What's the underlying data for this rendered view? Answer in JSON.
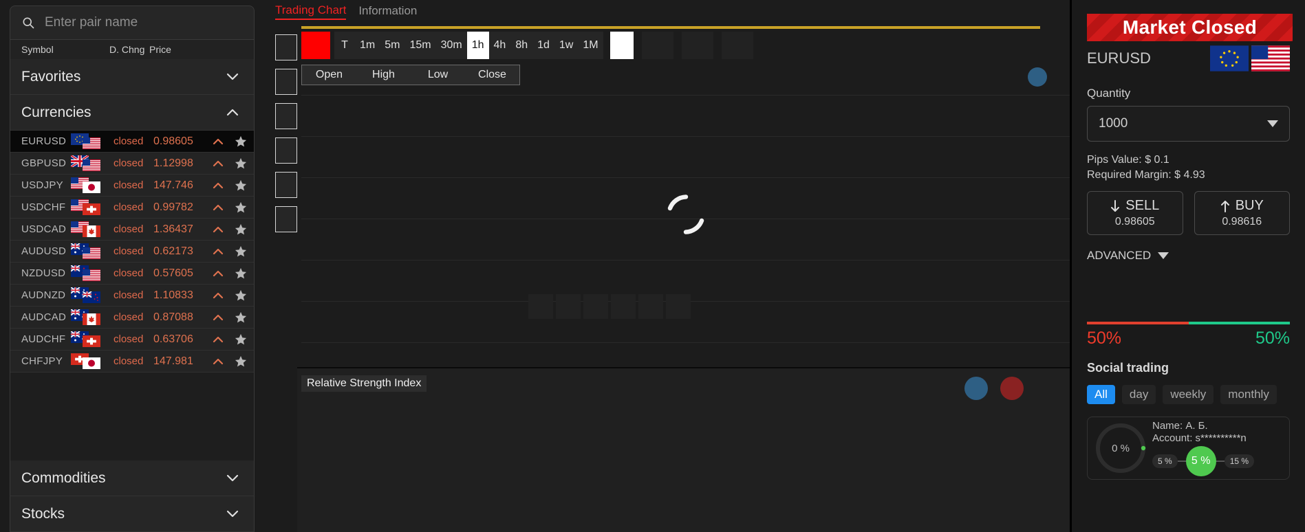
{
  "search": {
    "placeholder": "Enter pair name",
    "value": ""
  },
  "columns": {
    "symbol": "Symbol",
    "dchng": "D. Chng",
    "price": "Price"
  },
  "groups": {
    "favorites": "Favorites",
    "currencies": "Currencies",
    "commodities": "Commodities",
    "stocks": "Stocks"
  },
  "pairs": [
    {
      "symbol": "EURUSD",
      "status": "closed",
      "price": "0.98605",
      "f1": "eu",
      "f2": "us",
      "selected": true
    },
    {
      "symbol": "GBPUSD",
      "status": "closed",
      "price": "1.12998",
      "f1": "gb",
      "f2": "us",
      "selected": false
    },
    {
      "symbol": "USDJPY",
      "status": "closed",
      "price": "147.746",
      "f1": "us",
      "f2": "jp",
      "selected": false
    },
    {
      "symbol": "USDCHF",
      "status": "closed",
      "price": "0.99782",
      "f1": "us",
      "f2": "ch",
      "selected": false
    },
    {
      "symbol": "USDCAD",
      "status": "closed",
      "price": "1.36437",
      "f1": "us",
      "f2": "ca",
      "selected": false
    },
    {
      "symbol": "AUDUSD",
      "status": "closed",
      "price": "0.62173",
      "f1": "au",
      "f2": "us",
      "selected": false
    },
    {
      "symbol": "NZDUSD",
      "status": "closed",
      "price": "0.57605",
      "f1": "nz",
      "f2": "us",
      "selected": false
    },
    {
      "symbol": "AUDNZD",
      "status": "closed",
      "price": "1.10833",
      "f1": "au",
      "f2": "nz",
      "selected": false
    },
    {
      "symbol": "AUDCAD",
      "status": "closed",
      "price": "0.87088",
      "f1": "au",
      "f2": "ca",
      "selected": false
    },
    {
      "symbol": "AUDCHF",
      "status": "closed",
      "price": "0.63706",
      "f1": "au",
      "f2": "ch",
      "selected": false
    },
    {
      "symbol": "CHFJPY",
      "status": "closed",
      "price": "147.981",
      "f1": "ch",
      "f2": "jp",
      "selected": false
    }
  ],
  "tabs": {
    "trading_chart": "Trading Chart",
    "information": "Information"
  },
  "timeframes": [
    {
      "label": "T",
      "active": false
    },
    {
      "label": "1m",
      "active": false
    },
    {
      "label": "5m",
      "active": false
    },
    {
      "label": "15m",
      "active": false
    },
    {
      "label": "30m",
      "active": false
    },
    {
      "label": "1h",
      "active": true
    },
    {
      "label": "4h",
      "active": false
    },
    {
      "label": "8h",
      "active": false
    },
    {
      "label": "1d",
      "active": false
    },
    {
      "label": "1w",
      "active": false
    },
    {
      "label": "1M",
      "active": false
    }
  ],
  "ohlc": {
    "open": "Open",
    "high": "High",
    "low": "Low",
    "close": "Close"
  },
  "indicator": {
    "name": "Relative Strength Index"
  },
  "colors": {
    "accent_red": "#ef2222",
    "swatch": "#ff0000",
    "gold": "#c9a227",
    "sell": "#e0402e",
    "buy": "#1fc98a",
    "social_active": "#1d8cf0",
    "risk_active": "#4fc94f"
  },
  "panel": {
    "market_status": "Market Closed",
    "symbol": "EURUSD",
    "quantity_label": "Quantity",
    "quantity_value": "1000",
    "pips_value": "Pips Value: $ 0.1",
    "required_margin": "Required Margin: $ 4.93",
    "sell_label": "SELL",
    "sell_price": "0.98605",
    "buy_label": "BUY",
    "buy_price": "0.98616",
    "advanced": "ADVANCED",
    "sentiment_sell": "50%",
    "sentiment_buy": "50%",
    "social_title": "Social trading",
    "social_tabs": [
      {
        "label": "All",
        "active": true
      },
      {
        "label": "day",
        "active": false
      },
      {
        "label": "weekly",
        "active": false
      },
      {
        "label": "monthly",
        "active": false
      }
    ],
    "trader": {
      "gauge": "0 %",
      "name": "Name: А. Б.",
      "account": "Account: s**********n",
      "risk_low": "5 %",
      "risk_current": "5 %",
      "risk_high": "15 %"
    }
  }
}
